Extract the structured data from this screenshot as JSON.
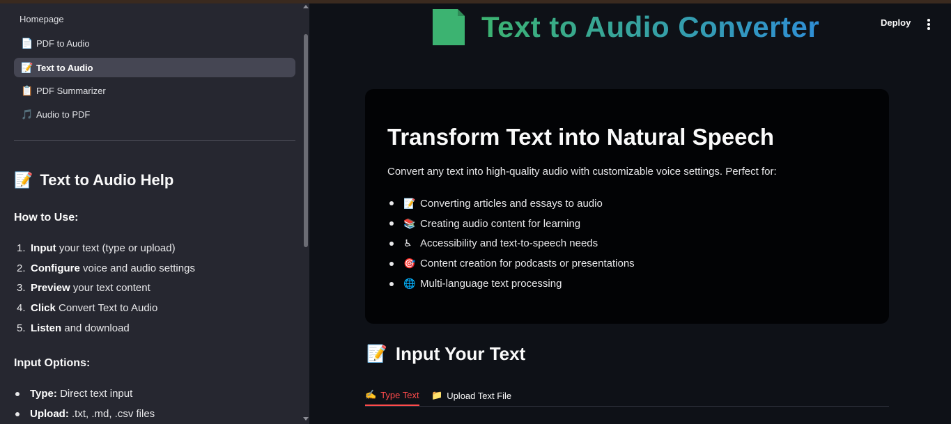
{
  "sidebar": {
    "home_label": "Homepage",
    "nav": [
      {
        "label": "PDF to Audio",
        "icon": "page-icon",
        "glyph": "📄"
      },
      {
        "label": "Text to Audio",
        "icon": "memo-icon",
        "glyph": "📝",
        "active": true
      },
      {
        "label": "PDF Summarizer",
        "icon": "clipboard-icon",
        "glyph": "📋"
      },
      {
        "label": "Audio to PDF",
        "icon": "music-note-icon",
        "glyph": "🎵"
      }
    ],
    "help": {
      "title": "Text to Audio Help",
      "title_glyph": "📝",
      "how_to_heading": "How to Use:",
      "steps": [
        {
          "num": "1.",
          "bold": "Input",
          "rest": " your text (type or upload)"
        },
        {
          "num": "2.",
          "bold": "Configure",
          "rest": " voice and audio settings"
        },
        {
          "num": "3.",
          "bold": "Preview",
          "rest": " your text content"
        },
        {
          "num": "4.",
          "bold": "Click",
          "rest": " Convert Text to Audio"
        },
        {
          "num": "5.",
          "bold": "Listen",
          "rest": " and download"
        }
      ],
      "options_heading": "Input Options:",
      "options": [
        {
          "bold": "Type:",
          "rest": " Direct text input"
        },
        {
          "bold": "Upload:",
          "rest": " .txt, .md, .csv files"
        }
      ]
    }
  },
  "header": {
    "title": "Text to Audio Converter",
    "deploy_label": "Deploy",
    "menu_icon": "kebab-menu-icon"
  },
  "hero": {
    "heading": "Transform Text into Natural Speech",
    "intro": "Convert any text into high-quality audio with customizable voice settings. Perfect for:",
    "items": [
      {
        "glyph": "📝",
        "text": "Converting articles and essays to audio"
      },
      {
        "glyph": "📚",
        "text": "Creating audio content for learning"
      },
      {
        "glyph": "♿",
        "text": "Accessibility and text-to-speech needs"
      },
      {
        "glyph": "🎯",
        "text": "Content creation for podcasts or presentations"
      },
      {
        "glyph": "🌐",
        "text": "Multi-language text processing"
      }
    ]
  },
  "input_section": {
    "heading": "Input Your Text",
    "heading_glyph": "📝",
    "tabs": [
      {
        "label": "Type Text",
        "glyph": "✍️",
        "active": true
      },
      {
        "label": "Upload Text File",
        "glyph": "📁",
        "active": false
      }
    ]
  },
  "colors": {
    "accent": "#ff4b4b",
    "title_gradient_start": "#3cb371",
    "title_gradient_end": "#2f8fd6",
    "sidebar_bg": "#262730",
    "main_bg": "#0e1117"
  }
}
